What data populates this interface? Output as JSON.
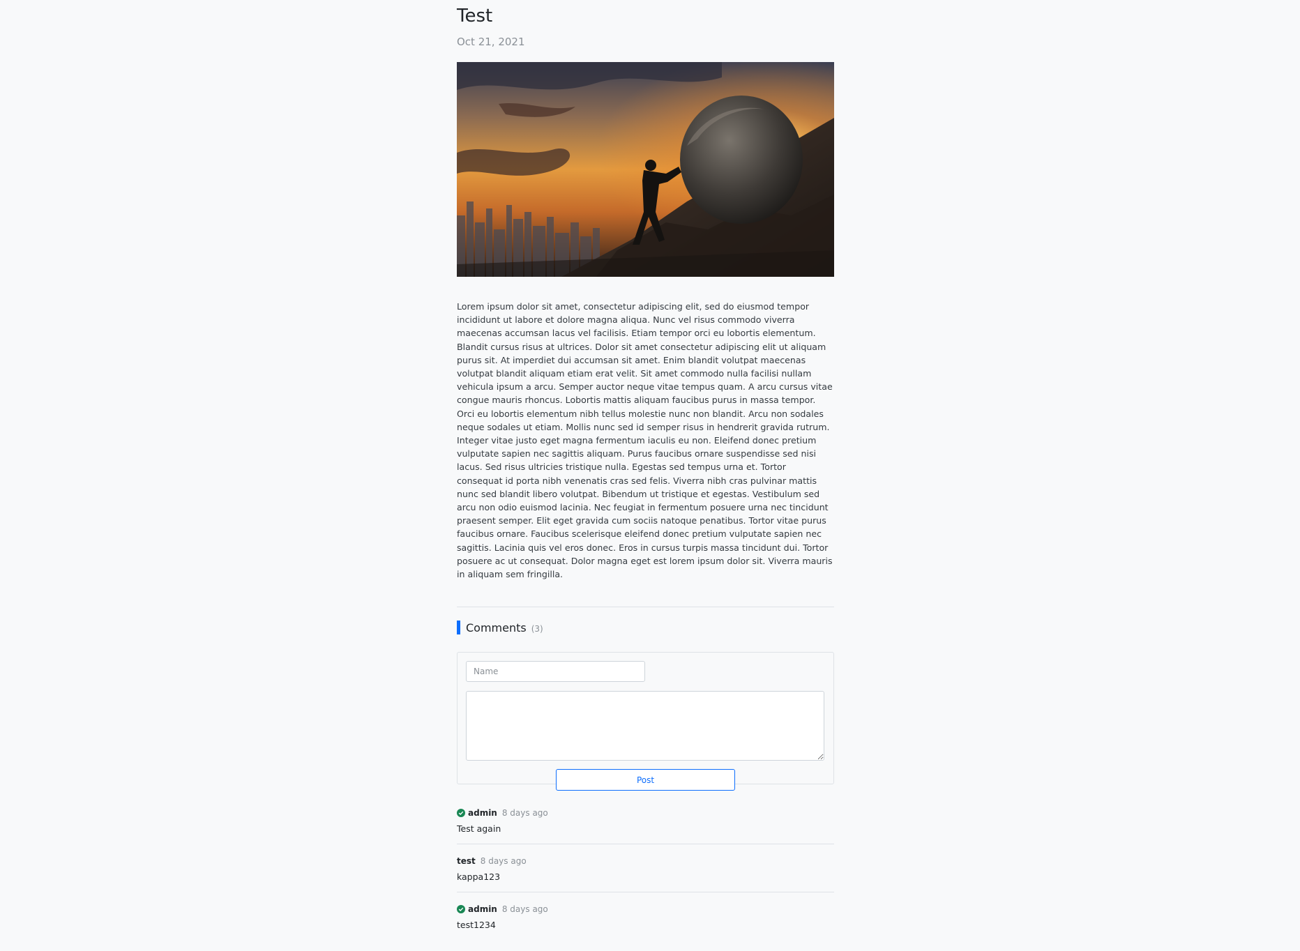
{
  "post": {
    "title": "Test",
    "date": "Oct 21, 2021",
    "body": "Lorem ipsum dolor sit amet, consectetur adipiscing elit, sed do eiusmod tempor incididunt ut labore et dolore magna aliqua. Nunc vel risus commodo viverra maecenas accumsan lacus vel facilisis. Etiam tempor orci eu lobortis elementum. Blandit cursus risus at ultrices. Dolor sit amet consectetur adipiscing elit ut aliquam purus sit. At imperdiet dui accumsan sit amet. Enim blandit volutpat maecenas volutpat blandit aliquam etiam erat velit. Sit amet commodo nulla facilisi nullam vehicula ipsum a arcu. Semper auctor neque vitae tempus quam. A arcu cursus vitae congue mauris rhoncus. Lobortis mattis aliquam faucibus purus in massa tempor. Orci eu lobortis elementum nibh tellus molestie nunc non blandit. Arcu non sodales neque sodales ut etiam. Mollis nunc sed id semper risus in hendrerit gravida rutrum. Integer vitae justo eget magna fermentum iaculis eu non. Eleifend donec pretium vulputate sapien nec sagittis aliquam. Purus faucibus ornare suspendisse sed nisi lacus. Sed risus ultricies tristique nulla. Egestas sed tempus urna et. Tortor consequat id porta nibh venenatis cras sed felis. Viverra nibh cras pulvinar mattis nunc sed blandit libero volutpat. Bibendum ut tristique et egestas. Vestibulum sed arcu non odio euismod lacinia. Nec feugiat in fermentum posuere urna nec tincidunt praesent semper. Elit eget gravida cum sociis natoque penatibus. Tortor vitae purus faucibus ornare. Faucibus scelerisque eleifend donec pretium vulputate sapien nec sagittis. Lacinia quis vel eros donec. Eros in cursus turpis massa tincidunt dui. Tortor posuere ac ut consequat. Dolor magna eget est lorem ipsum dolor sit. Viverra mauris in aliquam sem fringilla."
  },
  "comments": {
    "title": "Comments",
    "count": "(3)",
    "form": {
      "name_placeholder": "Name",
      "post_label": "Post"
    },
    "items": [
      {
        "author": "admin",
        "time": "8 days ago",
        "text": "Test again",
        "verified": true
      },
      {
        "author": "test",
        "time": "8 days ago",
        "text": "kappa123",
        "verified": false
      },
      {
        "author": "admin",
        "time": "8 days ago",
        "text": "test1234",
        "verified": true
      }
    ]
  },
  "colors": {
    "accent": "#0d6efd",
    "verified": "#198754",
    "background": "#f8f9fa"
  },
  "icons": {
    "verified": "check-circle-icon"
  }
}
